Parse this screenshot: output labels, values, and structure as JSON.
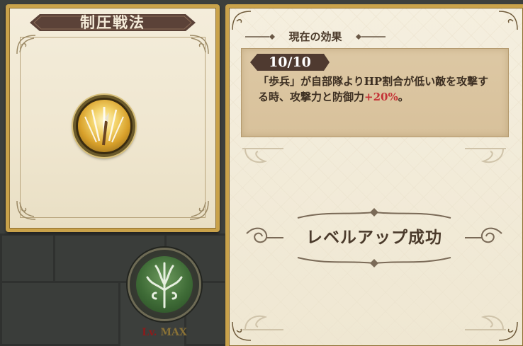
{
  "skill": {
    "title": "制圧戦法",
    "icon": "spear-burst-icon"
  },
  "level_badge": {
    "icon": "tree-emblem-icon",
    "prefix": "Lv.",
    "value": "MAX"
  },
  "effect": {
    "header": "現在の効果",
    "level": "10/10",
    "text_before": "「歩兵」が自部隊よりHP割合が低い敵を攻撃する時、攻撃力と防御力",
    "highlight": "+20%",
    "text_after": "。",
    "highlight_color": "#c43236"
  },
  "result": {
    "message": "レベルアップ成功"
  }
}
